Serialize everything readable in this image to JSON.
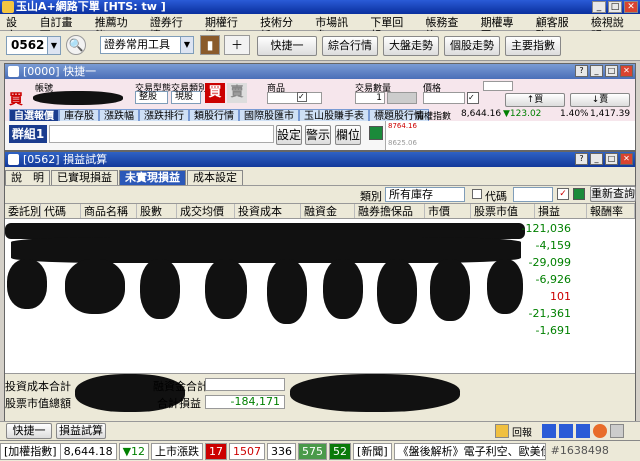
{
  "window": {
    "title": "玉山A+網路下單 [HTS: tw ]"
  },
  "menu": [
    "設定",
    "自訂畫面",
    "推薦功能",
    "證券行情",
    "期權行情",
    "技術分析",
    "市場訊息",
    "下單回報",
    "帳務查詢",
    "期權專區",
    "顧客服務",
    "檢視說明"
  ],
  "toolbar": {
    "stock_code": "0562",
    "tool_select": "證券常用工具",
    "buttons": [
      "快捷一",
      "綜合行情",
      "大盤走勢",
      "個股走勢",
      "主要指數"
    ]
  },
  "quick_window": {
    "title": "[0000] 快捷一",
    "buy_label": "買",
    "account_label": "帳號",
    "trade_type_label": "交易型態",
    "trade_type_value": "整股",
    "trade_cat_label": "交易類別",
    "trade_cat_value": "現股",
    "buy_btn": "買",
    "sell_btn": "賣",
    "product_label": "商品",
    "qty_label": "交易數量",
    "qty_value": "1",
    "price_label": "價格",
    "tabs": [
      "自選報價",
      "庫存股",
      "漲跌幅",
      "漲跌排行",
      "類股行情",
      "國際股匯市",
      "玉山股賺手表",
      "標題股行情"
    ],
    "index_label": "加權指數",
    "index_value": "8,644.16",
    "index_change": "▼123.02",
    "index_pct": "1.40%",
    "index_vol": "1,417.39 億",
    "group_label": "群組1",
    "btn_settings": "設定",
    "btn_alert": "警示",
    "btn_columns": "欄位",
    "chart_ticks": [
      "8764.16",
      "8625.06"
    ],
    "btn_buy": "↑買",
    "btn_sell": "↓賣"
  },
  "pl_window": {
    "title": "[0562] 損益試算",
    "tabs": [
      "說　明",
      "已實現損益",
      "未實現損益",
      "成本設定"
    ],
    "active_tab": 2,
    "category_label": "類別",
    "category_value": "所有庫存",
    "code_label": "代碼",
    "requery": "重新查詢",
    "columns": [
      "委託別",
      "代碼",
      "商品名稱",
      "股數",
      "成交均價",
      "投資成本",
      "融資金",
      "融券擔保品",
      "市價",
      "股票市值",
      "損益",
      "報酬率"
    ],
    "pl_values": [
      "-121,036",
      "-4,159",
      "-29,099",
      "-6,926",
      "101",
      "-21,361",
      "-1,691"
    ],
    "pl_colors": [
      "green",
      "green",
      "green",
      "green",
      "red",
      "green",
      "green"
    ],
    "footer": {
      "cost_label": "投資成本合計",
      "margin_label": "融資金合計",
      "market_label": "股票市值總額",
      "pl_label": "合計損益",
      "pl_total": "-184,171"
    }
  },
  "taskbar": {
    "items": [
      "快捷一",
      "損益試算"
    ],
    "report_btn": "回報"
  },
  "statusbar": {
    "index_label": "[加權指數]",
    "index_value": "8,644.18",
    "index_change": "▼12",
    "updown_label": "上市漲跌",
    "up1": "17",
    "up2": "1507",
    "flat": "336",
    "down1": "575",
    "down2": "52",
    "news_label": "[新聞]",
    "news_text": "《盤後解析》電子利空、歐美債災積",
    "watermark": "#1638498"
  }
}
